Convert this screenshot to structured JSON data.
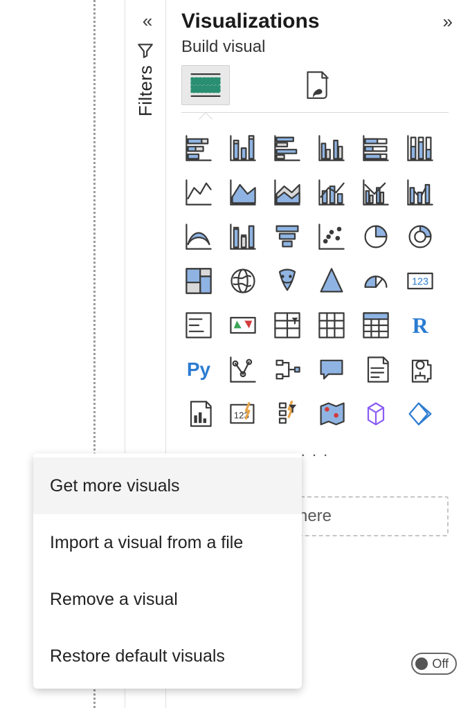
{
  "filters": {
    "label": "Filters"
  },
  "viz": {
    "title": "Visualizations",
    "subtitle": "Build visual",
    "tabs": {
      "build": "build-visual-tab",
      "format": "format-visual-tab"
    },
    "icons": [
      {
        "name": "stacked-bar-chart-icon"
      },
      {
        "name": "stacked-column-chart-icon"
      },
      {
        "name": "clustered-bar-chart-icon"
      },
      {
        "name": "clustered-column-chart-icon"
      },
      {
        "name": "hundred-percent-stacked-bar-chart-icon"
      },
      {
        "name": "hundred-percent-stacked-column-chart-icon"
      },
      {
        "name": "line-chart-icon"
      },
      {
        "name": "area-chart-icon"
      },
      {
        "name": "stacked-area-chart-icon"
      },
      {
        "name": "line-stacked-column-chart-icon"
      },
      {
        "name": "line-clustered-column-chart-icon"
      },
      {
        "name": "ribbon-chart-icon"
      },
      {
        "name": "waterfall-chart-icon"
      },
      {
        "name": "funnel-chart-icon"
      },
      {
        "name": "scatter-chart-icon"
      },
      {
        "name": "pie-chart-icon"
      },
      {
        "name": "donut-chart-icon"
      },
      {
        "name": "treemap-icon"
      },
      {
        "name": "map-icon"
      },
      {
        "name": "filled-map-icon"
      },
      {
        "name": "azure-map-icon"
      },
      {
        "name": "gauge-icon"
      },
      {
        "name": "card-icon",
        "label": "123"
      },
      {
        "name": "multi-row-card-icon"
      },
      {
        "name": "kpi-icon"
      },
      {
        "name": "slicer-icon"
      },
      {
        "name": "table-icon"
      },
      {
        "name": "matrix-icon"
      },
      {
        "name": "r-script-visual-icon",
        "label": "R"
      },
      {
        "name": "python-visual-icon",
        "label": "Py"
      },
      {
        "name": "key-influencers-icon"
      },
      {
        "name": "decomposition-tree-icon"
      },
      {
        "name": "qa-visual-icon"
      },
      {
        "name": "smart-narrative-icon"
      },
      {
        "name": "goals-icon"
      },
      {
        "name": "paginated-report-icon"
      },
      {
        "name": "power-apps-icon"
      },
      {
        "name": "power-automate-icon"
      },
      {
        "name": "arcgis-maps-icon"
      },
      {
        "name": "shape-map-icon"
      },
      {
        "name": "custom-visual-icon"
      }
    ],
    "more_label": ". . .",
    "drop_hint": "here",
    "toggle_label": "Off"
  },
  "context_menu": {
    "items": [
      {
        "label": "Get more visuals",
        "hovered": true
      },
      {
        "label": "Import a visual from a file",
        "hovered": false
      },
      {
        "label": "Remove a visual",
        "hovered": false
      },
      {
        "label": "Restore default visuals",
        "hovered": false
      }
    ]
  }
}
